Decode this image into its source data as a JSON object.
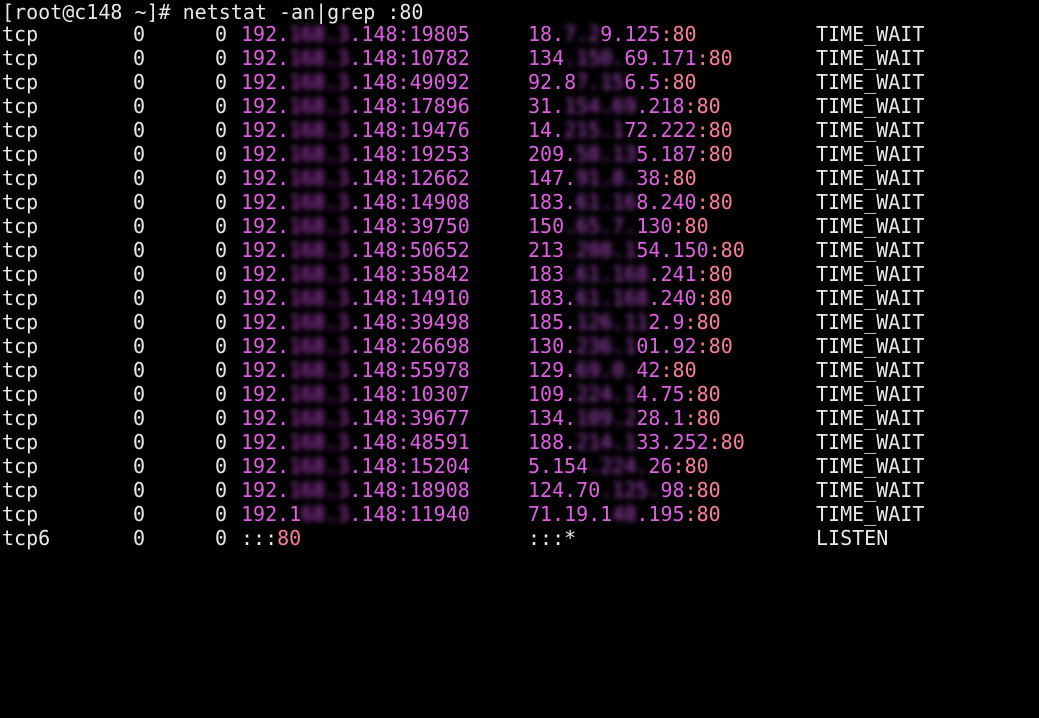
{
  "prompt": {
    "text": "[root@c148 ~]# netstat -an|grep :80"
  },
  "colors": {
    "background": "#000000",
    "text": "#e8e8e8",
    "address": "#e25ce6",
    "port": "#ff7a9a"
  },
  "rows": [
    {
      "proto": "tcp",
      "recv": "0",
      "send": "0",
      "local_a": "192.",
      "local_b": "168.3",
      "local_c": ".148:19805",
      "foreign_a": "18.",
      "foreign_b": "7.2",
      "foreign_c": "9.125",
      "foreign_port": ":80",
      "state": "TIME_WAIT"
    },
    {
      "proto": "tcp",
      "recv": "0",
      "send": "0",
      "local_a": "192.",
      "local_b": "168.3",
      "local_c": ".148:10782",
      "foreign_a": "134",
      "foreign_b": ".150.",
      "foreign_c": "69.171",
      "foreign_port": ":80",
      "state": "TIME_WAIT"
    },
    {
      "proto": "tcp",
      "recv": "0",
      "send": "0",
      "local_a": "192.",
      "local_b": "168.3",
      "local_c": ".148:49092",
      "foreign_a": "92.8",
      "foreign_b": "7.15",
      "foreign_c": "6.5",
      "foreign_port": ":80",
      "state": "TIME_WAIT"
    },
    {
      "proto": "tcp",
      "recv": "0",
      "send": "0",
      "local_a": "192.",
      "local_b": "168.3",
      "local_c": ".148:17896",
      "foreign_a": "31.",
      "foreign_b": "154.69",
      "foreign_c": ".218",
      "foreign_port": ":80",
      "state": "TIME_WAIT"
    },
    {
      "proto": "tcp",
      "recv": "0",
      "send": "0",
      "local_a": "192.",
      "local_b": "168.3",
      "local_c": ".148:19476",
      "foreign_a": "14.",
      "foreign_b": "215.1",
      "foreign_c": "72.222",
      "foreign_port": ":80",
      "state": "TIME_WAIT"
    },
    {
      "proto": "tcp",
      "recv": "0",
      "send": "0",
      "local_a": "192.",
      "local_b": "168.3",
      "local_c": ".148:19253",
      "foreign_a": "209.",
      "foreign_b": "58.13",
      "foreign_c": "5.187",
      "foreign_port": ":80",
      "state": "TIME_WAIT"
    },
    {
      "proto": "tcp",
      "recv": "0",
      "send": "0",
      "local_a": "192.",
      "local_b": "168.3",
      "local_c": ".148:12662",
      "foreign_a": "147.",
      "foreign_b": "91.8.",
      "foreign_c": "38",
      "foreign_port": ":80",
      "state": "TIME_WAIT"
    },
    {
      "proto": "tcp",
      "recv": "0",
      "send": "0",
      "local_a": "192.",
      "local_b": "168.3",
      "local_c": ".148:14908",
      "foreign_a": "183.",
      "foreign_b": "61.16",
      "foreign_c": "8.240",
      "foreign_port": ":80",
      "state": "TIME_WAIT"
    },
    {
      "proto": "tcp",
      "recv": "0",
      "send": "0",
      "local_a": "192.",
      "local_b": "168.3",
      "local_c": ".148:39750",
      "foreign_a": "150",
      "foreign_b": ".65.7.",
      "foreign_c": "130",
      "foreign_port": ":80",
      "state": "TIME_WAIT"
    },
    {
      "proto": "tcp",
      "recv": "0",
      "send": "0",
      "local_a": "192.",
      "local_b": "168.3",
      "local_c": ".148:50652",
      "foreign_a": "213",
      "foreign_b": ".208.1",
      "foreign_c": "54.150",
      "foreign_port": ":80",
      "state": "TIME_WAIT"
    },
    {
      "proto": "tcp",
      "recv": "0",
      "send": "0",
      "local_a": "192.",
      "local_b": "168.3",
      "local_c": ".148:35842",
      "foreign_a": "183",
      "foreign_b": ".61.168",
      "foreign_c": ".241",
      "foreign_port": ":80",
      "state": "TIME_WAIT"
    },
    {
      "proto": "tcp",
      "recv": "0",
      "send": "0",
      "local_a": "192.",
      "local_b": "168.3",
      "local_c": ".148:14910",
      "foreign_a": "183.",
      "foreign_b": "61.168",
      "foreign_c": ".240",
      "foreign_port": ":80",
      "state": "TIME_WAIT"
    },
    {
      "proto": "tcp",
      "recv": "0",
      "send": "0",
      "local_a": "192.",
      "local_b": "168.3",
      "local_c": ".148:39498",
      "foreign_a": "185.",
      "foreign_b": "126.11",
      "foreign_c": "2.9",
      "foreign_port": ":80",
      "state": "TIME_WAIT"
    },
    {
      "proto": "tcp",
      "recv": "0",
      "send": "0",
      "local_a": "192.",
      "local_b": "168.3",
      "local_c": ".148:26698",
      "foreign_a": "130.",
      "foreign_b": "236.1",
      "foreign_c": "01.92",
      "foreign_port": ":80",
      "state": "TIME_WAIT"
    },
    {
      "proto": "tcp",
      "recv": "0",
      "send": "0",
      "local_a": "192.",
      "local_b": "168.3",
      "local_c": ".148:55978",
      "foreign_a": "129.",
      "foreign_b": "69.0.",
      "foreign_c": "42",
      "foreign_port": ":80",
      "state": "TIME_WAIT"
    },
    {
      "proto": "tcp",
      "recv": "0",
      "send": "0",
      "local_a": "192.",
      "local_b": "168.3",
      "local_c": ".148:10307",
      "foreign_a": "109.",
      "foreign_b": "224.1",
      "foreign_c": "4.75",
      "foreign_port": ":80",
      "state": "TIME_WAIT"
    },
    {
      "proto": "tcp",
      "recv": "0",
      "send": "0",
      "local_a": "192.",
      "local_b": "168.3",
      "local_c": ".148:39677",
      "foreign_a": "134.",
      "foreign_b": "109.2",
      "foreign_c": "28.1",
      "foreign_port": ":80",
      "state": "TIME_WAIT"
    },
    {
      "proto": "tcp",
      "recv": "0",
      "send": "0",
      "local_a": "192.",
      "local_b": "168.3",
      "local_c": ".148:48591",
      "foreign_a": "188.",
      "foreign_b": "214.1",
      "foreign_c": "33.252",
      "foreign_port": ":80",
      "state": "TIME_WAIT"
    },
    {
      "proto": "tcp",
      "recv": "0",
      "send": "0",
      "local_a": "192.",
      "local_b": "168.3",
      "local_c": ".148:15204",
      "foreign_a": "5.154",
      "foreign_b": ".224.",
      "foreign_c": "26",
      "foreign_port": ":80",
      "state": "TIME_WAIT"
    },
    {
      "proto": "tcp",
      "recv": "0",
      "send": "0",
      "local_a": "192.",
      "local_b": "168.3",
      "local_c": ".148:18908",
      "foreign_a": "124.70",
      "foreign_b": ".125.",
      "foreign_c": "98",
      "foreign_port": ":80",
      "state": "TIME_WAIT"
    },
    {
      "proto": "tcp",
      "recv": "0",
      "send": "0",
      "local_a": "192.1",
      "local_b": "68.3",
      "local_c": ".148:11940",
      "foreign_a": "71.19.1",
      "foreign_b": "48",
      "foreign_c": ".195",
      "foreign_port": ":80",
      "state": "TIME_WAIT"
    }
  ],
  "listen_row": {
    "proto": "tcp6",
    "recv": "0",
    "send": "0",
    "local_prefix": ":::",
    "local_port": "80",
    "foreign": ":::*",
    "state": "LISTEN"
  }
}
